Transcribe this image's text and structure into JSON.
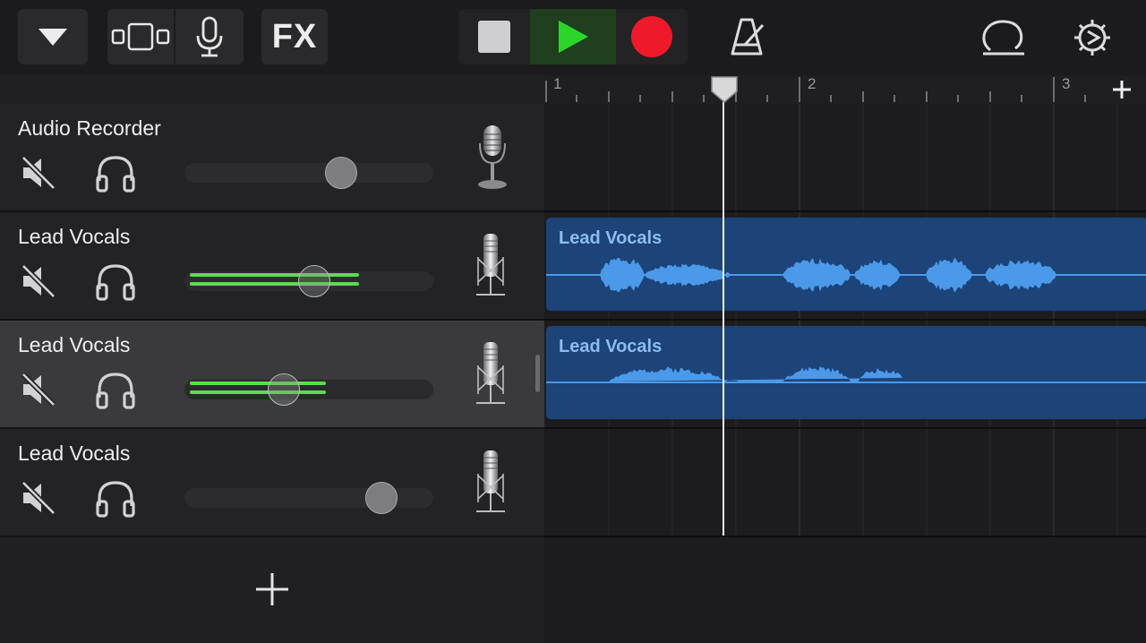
{
  "toolbar": {
    "buttons": [
      {
        "name": "browser-menu",
        "icon": "triangle-down-icon"
      },
      {
        "name": "view-toggle",
        "icon": "tracks-view-icon"
      },
      {
        "name": "instrument",
        "icon": "microphone-icon"
      },
      {
        "name": "fx",
        "label": "FX"
      },
      {
        "name": "stop",
        "icon": "stop-icon"
      },
      {
        "name": "play",
        "icon": "play-icon"
      },
      {
        "name": "record",
        "icon": "record-icon"
      },
      {
        "name": "metronome",
        "icon": "metronome-icon"
      },
      {
        "name": "loop-browser",
        "icon": "loop-icon"
      },
      {
        "name": "settings",
        "icon": "gear-icon"
      }
    ],
    "fx_label": "FX"
  },
  "ruler": {
    "bars": [
      "1",
      "2",
      "3"
    ],
    "add_section_icon": "plus-icon"
  },
  "tracks": [
    {
      "name": "Audio Recorder",
      "volume": 0.63,
      "meter": 0,
      "icon": "vintage-microphone-icon",
      "selected": false
    },
    {
      "name": "Lead Vocals",
      "volume": 0.52,
      "meter": 0.7,
      "icon": "condenser-microphone-icon",
      "selected": false
    },
    {
      "name": "Lead Vocals",
      "volume": 0.4,
      "meter": 0.57,
      "icon": "condenser-microphone-icon",
      "selected": true
    },
    {
      "name": "Lead Vocals",
      "volume": 0.79,
      "meter": 0,
      "icon": "condenser-microphone-icon",
      "selected": false
    }
  ],
  "regions": [
    {
      "label": "Lead Vocals",
      "track": 2
    },
    {
      "label": "Lead Vocals",
      "track": 3
    }
  ],
  "colors": {
    "play_active": "#1f3f1f",
    "play_icon": "#2bd62b",
    "record": "#ee1a2b",
    "meter": "#5ddb4f",
    "region": "#1c4479",
    "waveform": "#4b99e9",
    "region_label": "#8cbcf0"
  }
}
